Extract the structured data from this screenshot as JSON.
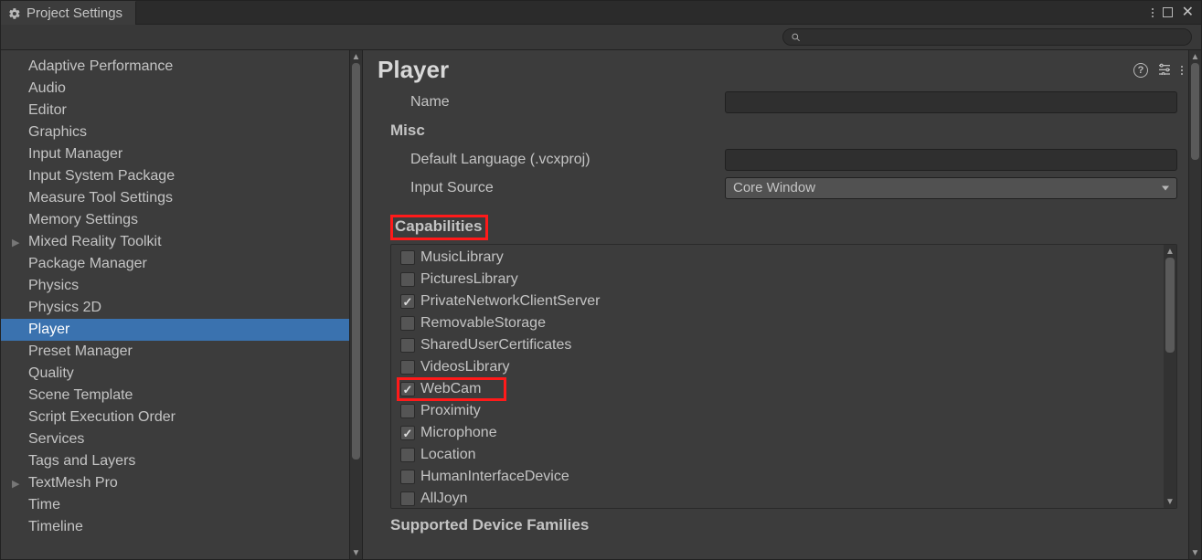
{
  "titlebar": {
    "tab_label": "Project Settings"
  },
  "search": {
    "placeholder": ""
  },
  "sidebar": {
    "items": [
      {
        "label": "Adaptive Performance",
        "expandable": false
      },
      {
        "label": "Audio",
        "expandable": false
      },
      {
        "label": "Editor",
        "expandable": false
      },
      {
        "label": "Graphics",
        "expandable": false
      },
      {
        "label": "Input Manager",
        "expandable": false
      },
      {
        "label": "Input System Package",
        "expandable": false
      },
      {
        "label": "Measure Tool Settings",
        "expandable": false
      },
      {
        "label": "Memory Settings",
        "expandable": false
      },
      {
        "label": "Mixed Reality Toolkit",
        "expandable": true
      },
      {
        "label": "Package Manager",
        "expandable": false
      },
      {
        "label": "Physics",
        "expandable": false
      },
      {
        "label": "Physics 2D",
        "expandable": false
      },
      {
        "label": "Player",
        "expandable": false,
        "selected": true
      },
      {
        "label": "Preset Manager",
        "expandable": false
      },
      {
        "label": "Quality",
        "expandable": false
      },
      {
        "label": "Scene Template",
        "expandable": false
      },
      {
        "label": "Script Execution Order",
        "expandable": false
      },
      {
        "label": "Services",
        "expandable": false
      },
      {
        "label": "Tags and Layers",
        "expandable": false
      },
      {
        "label": "TextMesh Pro",
        "expandable": true
      },
      {
        "label": "Time",
        "expandable": false
      },
      {
        "label": "Timeline",
        "expandable": false
      }
    ]
  },
  "main": {
    "title": "Player",
    "fields": {
      "name_label": "Name",
      "name_value": ""
    },
    "misc": {
      "heading": "Misc",
      "default_lang_label": "Default Language (.vcxproj)",
      "default_lang_value": "",
      "input_source_label": "Input Source",
      "input_source_value": "Core Window"
    },
    "capabilities": {
      "heading": "Capabilities",
      "items": [
        {
          "label": "MusicLibrary",
          "checked": false
        },
        {
          "label": "PicturesLibrary",
          "checked": false
        },
        {
          "label": "PrivateNetworkClientServer",
          "checked": true
        },
        {
          "label": "RemovableStorage",
          "checked": false
        },
        {
          "label": "SharedUserCertificates",
          "checked": false
        },
        {
          "label": "VideosLibrary",
          "checked": false
        },
        {
          "label": "WebCam",
          "checked": true,
          "highlight": true
        },
        {
          "label": "Proximity",
          "checked": false
        },
        {
          "label": "Microphone",
          "checked": true
        },
        {
          "label": "Location",
          "checked": false
        },
        {
          "label": "HumanInterfaceDevice",
          "checked": false
        },
        {
          "label": "AllJoyn",
          "checked": false
        }
      ]
    },
    "supported": {
      "heading": "Supported Device Families"
    }
  }
}
